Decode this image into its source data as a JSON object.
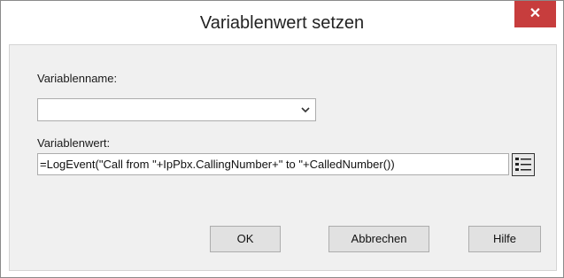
{
  "window": {
    "title": "Variablenwert setzen",
    "close_symbol": "✕"
  },
  "form": {
    "name_label": "Variablenname:",
    "name_value": "",
    "value_label": "Variablenwert:",
    "value_text": "=LogEvent(\"Call from \"+IpPbx.CallingNumber+\" to \"+CalledNumber())"
  },
  "buttons": {
    "ok_label": "OK",
    "cancel_label": "Abbrechen",
    "help_label": "Hilfe"
  },
  "icons": {
    "close": "close-icon",
    "dropdown": "chevron-down-icon",
    "list": "list-icon"
  },
  "colors": {
    "close_button": "#c73d3d",
    "panel_bg": "#f0f0f0"
  }
}
